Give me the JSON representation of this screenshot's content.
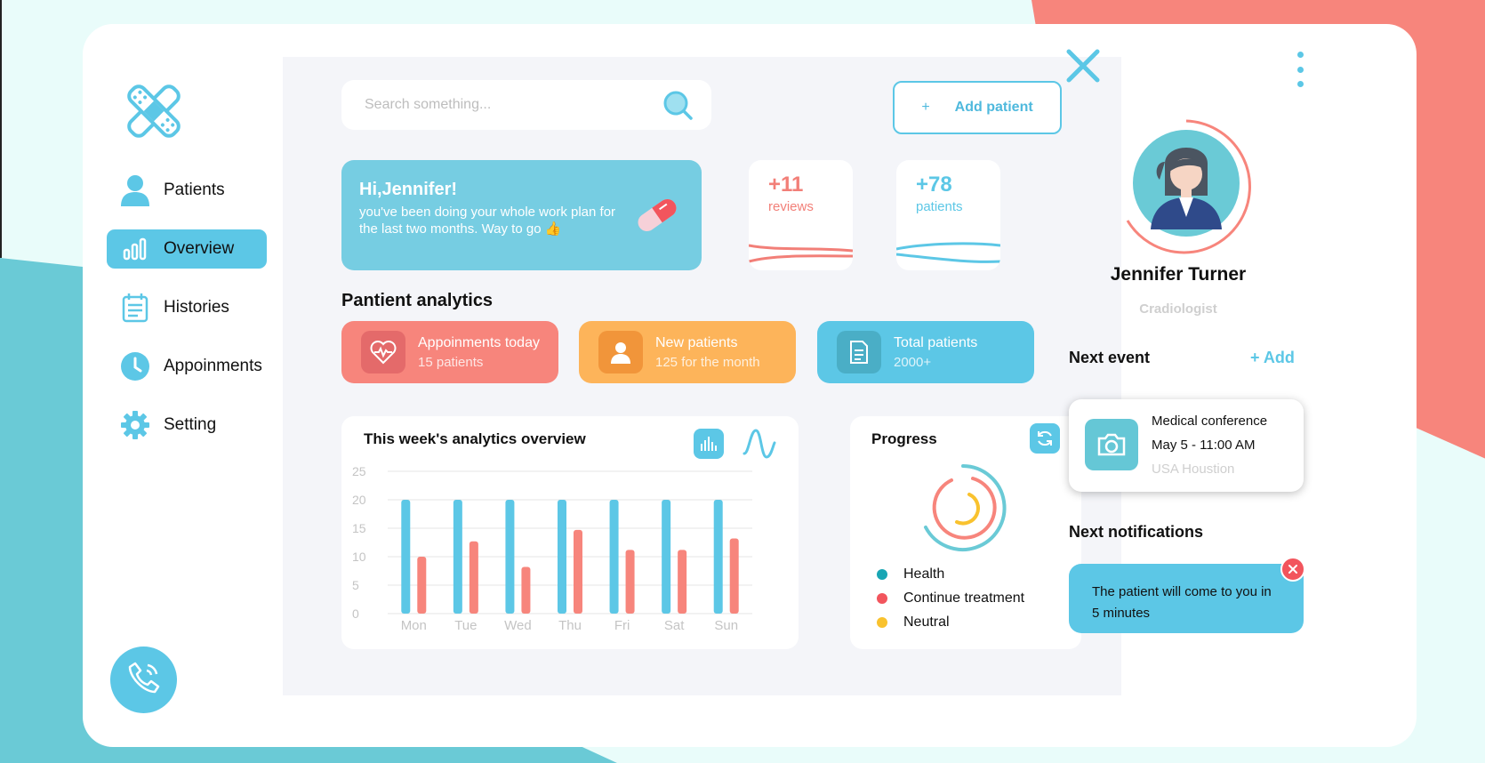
{
  "sidebar": {
    "items": [
      {
        "label": "Patients",
        "icon": "user-icon",
        "active": false
      },
      {
        "label": "Overview",
        "icon": "bar-chart-icon",
        "active": true
      },
      {
        "label": "Histories",
        "icon": "calendar-icon",
        "active": false
      },
      {
        "label": "Appoinments",
        "icon": "clock-icon",
        "active": false
      },
      {
        "label": "Setting",
        "icon": "gear-icon",
        "active": false
      }
    ]
  },
  "search": {
    "placeholder": "Search something..."
  },
  "toolbar": {
    "add_patient_plus": "+",
    "add_patient_label": "Add patient"
  },
  "greeting": {
    "title": "Hi,Jennifer!",
    "message": "you've been doing your whole work plan for the last two months. Way to go 👍"
  },
  "stats": [
    {
      "value": "+11",
      "label": "reviews",
      "color": "#f27f78"
    },
    {
      "value": "+78",
      "label": "patients",
      "color": "#5cc7e6"
    }
  ],
  "analytics": {
    "title": "Pantient analytics",
    "cards": [
      {
        "title": "Appoinments today",
        "subtitle": "15 patients",
        "color": "#f7857c",
        "icon": "heartbeat-icon"
      },
      {
        "title": "New patients",
        "subtitle": "125 for the month",
        "color": "#fdb45a",
        "icon": "person-icon"
      },
      {
        "title": "Total patients",
        "subtitle": "2000+",
        "color": "#5cc7e6",
        "icon": "document-icon"
      }
    ]
  },
  "weekly": {
    "title": "This week's analytics overview"
  },
  "chart_data": {
    "type": "bar",
    "categories": [
      "Mon",
      "Tue",
      "Wed",
      "Thu",
      "Fri",
      "Sat",
      "Sun"
    ],
    "series": [
      {
        "values": [
          20,
          20,
          20,
          20,
          20,
          20,
          20
        ],
        "color": "#5cc7e6"
      },
      {
        "values": [
          10,
          12.7,
          8.2,
          14.7,
          11.2,
          11.2,
          13.2
        ],
        "color": "#f7857c"
      }
    ],
    "yticks": [
      "25",
      "20",
      "15",
      "10",
      "5",
      "0"
    ],
    "ylim": [
      0,
      25
    ],
    "grid": true
  },
  "progress": {
    "title": "Progress",
    "legend": [
      {
        "label": "Health",
        "color": "#19a6b4"
      },
      {
        "label": "Continue treatment",
        "color": "#f2555d"
      },
      {
        "label": "Neutral",
        "color": "#f9c22e"
      }
    ]
  },
  "profile": {
    "name": "Jennifer Turner",
    "role": "Cradiologist"
  },
  "next_event": {
    "title": "Next event",
    "add_label": "+ Add",
    "event": {
      "name": "Medical conference",
      "date": "May 5 - 11:00 AM",
      "location": "USA Houstion"
    }
  },
  "notifications": {
    "title": "Next notifications",
    "message": "The patient will come to you in 5 minutes"
  }
}
